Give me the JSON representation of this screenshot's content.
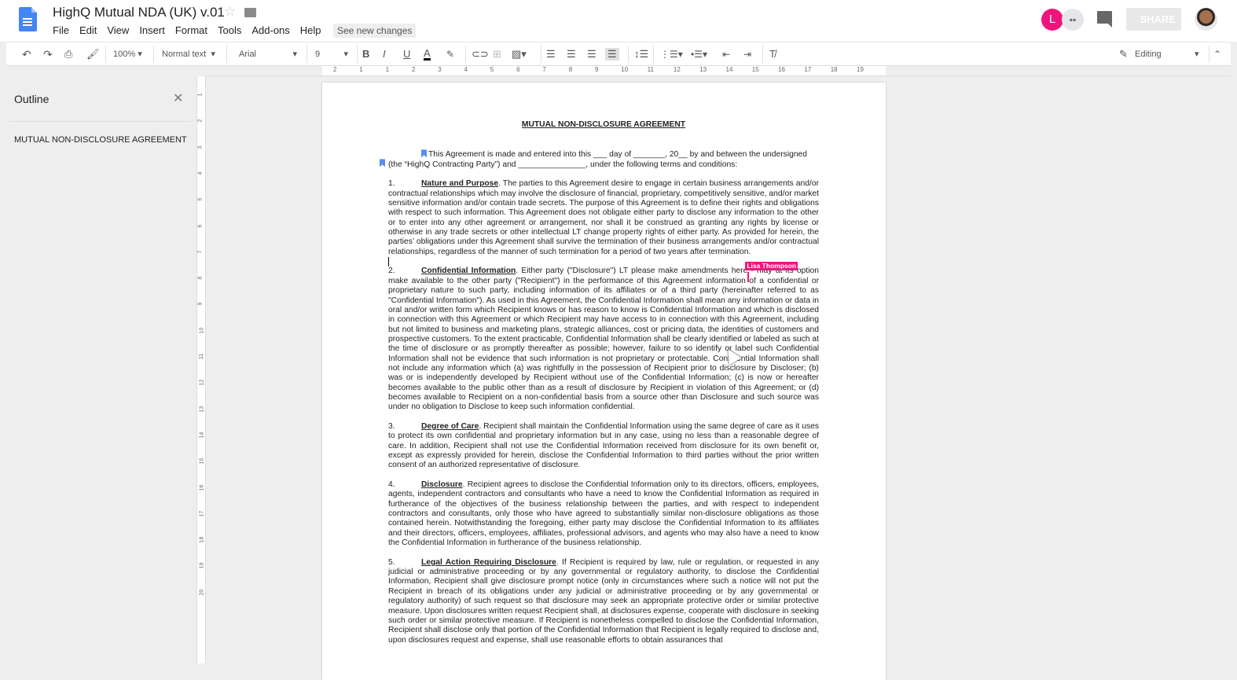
{
  "header": {
    "title": "HighQ Mutual NDA (UK) v.01",
    "menu": [
      "File",
      "Edit",
      "View",
      "Insert",
      "Format",
      "Tools",
      "Add-ons",
      "Help"
    ],
    "see_changes": "See new changes",
    "collaborator_initial": "L",
    "share_label": "SHARE"
  },
  "toolbar": {
    "zoom": "100%",
    "style": "Normal text",
    "font": "Arial",
    "size": "9",
    "bold": "B",
    "italic": "I",
    "underline": "U",
    "text_color": "A",
    "mode": "Editing",
    "text_color_hex": "#000000"
  },
  "ruler": {
    "h_labels": [
      "2",
      "1",
      "1",
      "2",
      "3",
      "4",
      "5",
      "6",
      "7",
      "8",
      "9",
      "10",
      "11",
      "12",
      "13",
      "14",
      "15",
      "16",
      "17",
      "18",
      "19"
    ],
    "v_labels": [
      "1",
      "2",
      "3",
      "4",
      "5",
      "6",
      "7",
      "8",
      "9",
      "10",
      "11",
      "12",
      "13",
      "14",
      "15",
      "16",
      "17",
      "18",
      "19",
      "20"
    ]
  },
  "outline": {
    "title": "Outline",
    "items": [
      "MUTUAL NON-DISCLOSURE AGREEMENT"
    ]
  },
  "document": {
    "title": "MUTUAL NON-DISCLOSURE AGREEMENT",
    "intro": "This Agreement is made and entered into this ___ day of _______, 20__ by and between the undersigned (the “HighQ Contracting Party”) and _______________,  under the following terms and conditions:",
    "collaborator": "Lisa Thompson",
    "sections": [
      {
        "num": "1.",
        "heading": "Nature and Purpose",
        "body": ".  The parties to this Agreement desire to engage in certain business arrangements and/or contractual relationships which may involve the disclosure of financial, proprietary, competitively sensitive, and/or market sensitive information and/or contain trade secrets.  The purpose of this Agreement is to define their rights and obligations with respect to such information.  This Agreement does not obligate either party to disclose any information to the other or to enter into any other agreement or arrangement, nor shall it be construed as granting any rights by license or otherwise in any trade secrets or other intellectual LT change property rights of either party.  As provided for herein, the parties’ obligations under this Agreement shall survive the termination of their business arrangements and/or contractual relationships, regardless of the manner of such termination for a period of two years after termination."
      },
      {
        "num": "2.",
        "heading": "Confidential Information",
        "body": ".  Either party (\"Disclosure\") LT  please make amendments here",
        "body_after": " - may at its option make available to the other party (\"Recipient\") in the performance of this Agreement information of a confidential or proprietary nature to such party, including information of its affiliates or of a third party (hereinafter referred to as \"Confidential Information\").  As used in this Agreement, the Confidential Information shall mean any information or data in oral and/or written form which Recipient knows or has reason to know is Confidential Information and which is disclosed in connection with this Agreement or which Recipient may have access to in connection with this Agreement, including but not limited to business and marketing plans, strategic alliances, cost or pricing data, the identities of customers and prospective customers.  To the extent practicable, Confidential Information shall be clearly identified or labeled as such at the time of disclosure or as promptly thereafter as possible; however, failure to so identify or label such Confidential Information shall not be evidence that such information is not proprietary or protectable.  Confidential Information shall not include any information which (a) was rightfully in the possession of Recipient prior to disclosure by Discloser; (b) was or is independently developed by Recipient without use of the Confidential Information;  (c) is now or hereafter becomes available to the public other than as a result of disclosure by Recipient in violation of this Agreement; or (d) becomes available to Recipient on a non-confidential basis from a source other than Disclosure and such source was under no obligation to Disclose to keep such information confidential."
      },
      {
        "num": "3.",
        "heading": "Degree of Care",
        "body": ".  Recipient shall maintain the Confidential Information using the same degree of care as it uses to protect its own confidential and proprietary information but in any case, using no less than a reasonable degree of care.  In addition, Recipient shall not use the Confidential Information received from disclosure for its own benefit or, except as expressly provided for herein, disclose the Confidential Information to third parties without the prior written consent of an authorized representative of disclosure."
      },
      {
        "num": "4.",
        "heading": "Disclosure",
        "body": ".  Recipient agrees to disclose the Confidential Information only to its directors, officers, employees, agents, independent contractors and consultants who have a need to know the Confidential Information as required in furtherance of the objectives of the business relationship between the parties, and with respect to independent contractors and consultants, only those who have agreed to substantially similar non-disclosure obligations as those contained herein. Notwithstanding the foregoing, either party may disclose the Confidential Information to its affiliates and their directors, officers, employees, affiliates, professional advisors, and agents who may also have a need to know the Confidential Information in furtherance of the business relationship."
      },
      {
        "num": "5.",
        "heading": "Legal Action Requiring Disclosure",
        "body": ".  If Recipient is required by law, rule or regulation, or requested in any judicial or administrative proceeding or by any governmental or regulatory authority, to disclose the Confidential Information, Recipient shall give disclosure prompt notice (only in circumstances where such a notice will not put the Recipient in breach of its obligations under any judicial or administrative proceeding or by any governmental or regulatory authority)  of such request so that disclosure may seek an appropriate protective order or similar protective measure.  Upon disclosures written request Recipient shall, at disclosures expense, cooperate with disclosure in seeking such order or similar protective measure.  If Recipient is nonetheless compelled to disclose the Confidential Information, Recipient shall disclose only that portion of the Confidential Information that Recipient is legally required to disclose and, upon disclosures request and expense, shall use reasonable efforts to obtain assurances that"
      }
    ]
  },
  "colors": {
    "accent": "#4285f4",
    "collaborator": "#f0157d"
  }
}
